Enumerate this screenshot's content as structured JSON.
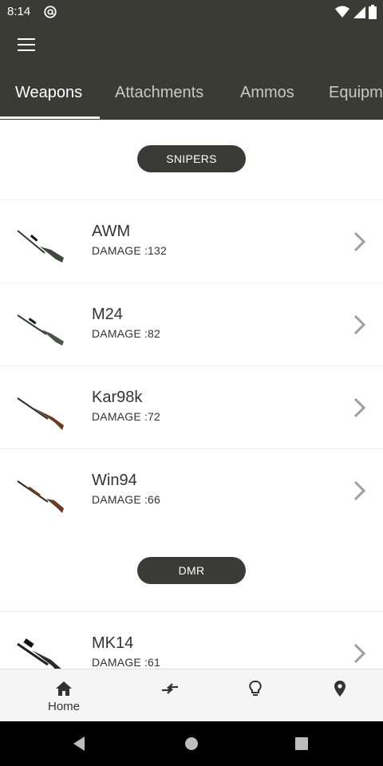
{
  "status_bar": {
    "time": "8:14"
  },
  "tabs": [
    {
      "label": "Weapons"
    },
    {
      "label": "Attachments"
    },
    {
      "label": "Ammos"
    },
    {
      "label": "Equipm"
    }
  ],
  "sections": {
    "snipers": "SNIPERS",
    "dmr": "DMR"
  },
  "weapons": [
    {
      "name": "AWM",
      "damage": "DAMAGE :132"
    },
    {
      "name": "M24",
      "damage": "DAMAGE :82"
    },
    {
      "name": "Kar98k",
      "damage": "DAMAGE :72"
    },
    {
      "name": "Win94",
      "damage": "DAMAGE :66"
    },
    {
      "name": "MK14",
      "damage": "DAMAGE :61"
    }
  ],
  "bottom_nav": {
    "home_label": "Home"
  },
  "colors": {
    "bar": "#3b3b36",
    "pill": "#3a3a36",
    "chevron": "#9e9e9e"
  }
}
